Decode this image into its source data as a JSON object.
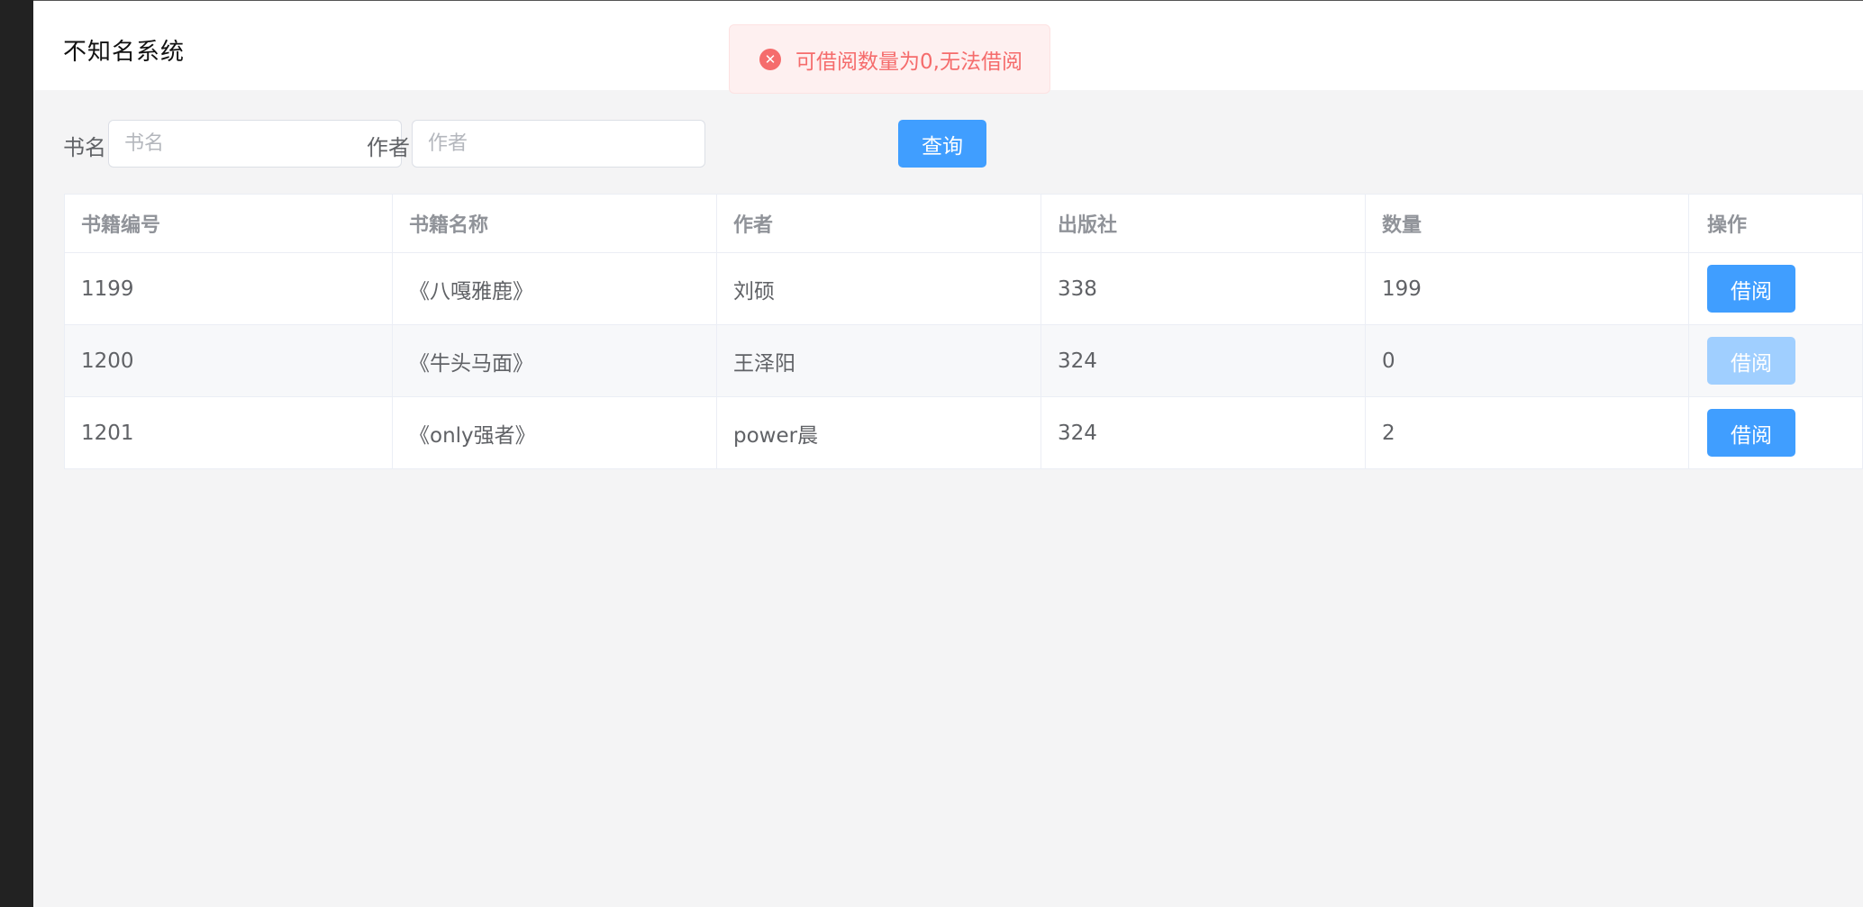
{
  "header": {
    "title": "不知名系统"
  },
  "toast": {
    "type": "error",
    "icon": "error-circle-icon",
    "message": "可借阅数量为0,无法借阅"
  },
  "search": {
    "book_label": "书名",
    "book_placeholder": "书名",
    "book_value": "",
    "author_label": "作者",
    "author_placeholder": "作者",
    "author_value": "",
    "query_button": "查询"
  },
  "table": {
    "columns": [
      "书籍编号",
      "书籍名称",
      "作者",
      "出版社",
      "数量",
      "操作"
    ],
    "rows": [
      {
        "id": "1199",
        "name": "《八嘎雅鹿》",
        "author": "刘硕",
        "publisher": "338",
        "count": "199",
        "action": "借阅",
        "disabled": false
      },
      {
        "id": "1200",
        "name": "《牛头马面》",
        "author": "王泽阳",
        "publisher": "324",
        "count": "0",
        "action": "借阅",
        "disabled": true
      },
      {
        "id": "1201",
        "name": "《only强者》",
        "author": "power晨",
        "publisher": "324",
        "count": "2",
        "action": "借阅",
        "disabled": false
      }
    ]
  },
  "colors": {
    "primary": "#409eff",
    "primary_disabled": "#a0cfff",
    "error": "#f56c6c",
    "error_bg": "#fef0f0",
    "page_bg": "#f4f4f5",
    "sidebar": "#222222"
  }
}
